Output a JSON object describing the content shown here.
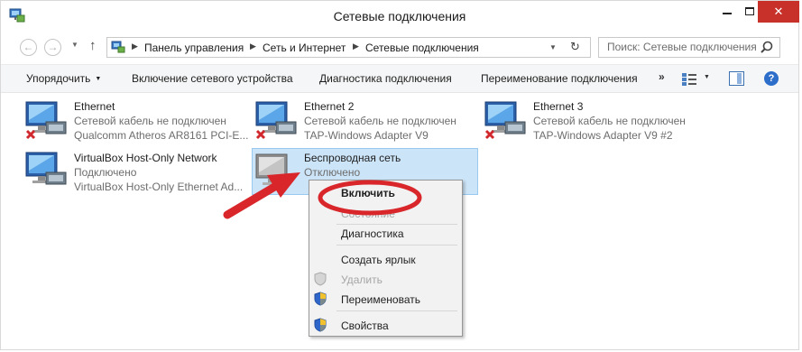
{
  "window": {
    "title": "Сетевые подключения",
    "close_glyph": "✕"
  },
  "nav": {
    "back_glyph": "←",
    "forward_glyph": "→",
    "up_glyph": "↑",
    "breadcrumbs": [
      "Панель управления",
      "Сеть и Интернет",
      "Сетевые подключения"
    ],
    "search_placeholder": "Поиск: Сетевые подключения"
  },
  "toolbar": {
    "organize": "Упорядочить",
    "enable_device": "Включение сетевого устройства",
    "diagnose": "Диагностика подключения",
    "rename": "Переименование подключения",
    "more": "»",
    "help": "?"
  },
  "connections": [
    {
      "name": "Ethernet",
      "status": "Сетевой кабель не подключен",
      "device": "Qualcomm Atheros AR8161 PCI-E...",
      "icon": "ethernet-disconnected-icon"
    },
    {
      "name": "Ethernet 2",
      "status": "Сетевой кабель не подключен",
      "device": "TAP-Windows Adapter V9",
      "icon": "ethernet-disconnected-icon"
    },
    {
      "name": "Ethernet 3",
      "status": "Сетевой кабель не подключен",
      "device": "TAP-Windows Adapter V9 #2",
      "icon": "ethernet-disconnected-icon"
    },
    {
      "name": "VirtualBox Host-Only Network",
      "status": "Подключено",
      "device": "VirtualBox Host-Only Ethernet Ad...",
      "icon": "ethernet-connected-icon"
    },
    {
      "name": "Беспроводная сеть",
      "status": "Отключено",
      "device": "",
      "icon": "wireless-disabled-icon"
    }
  ],
  "context_menu": {
    "enable": "Включить",
    "status": "Состояние",
    "diagnostics": "Диагностика",
    "create_shortcut": "Создать ярлык",
    "delete": "Удалить",
    "rename": "Переименовать",
    "properties": "Свойства"
  },
  "colors": {
    "annotation_red": "#d8262b",
    "selection": "#cce4f7",
    "close_button": "#c7312a"
  }
}
